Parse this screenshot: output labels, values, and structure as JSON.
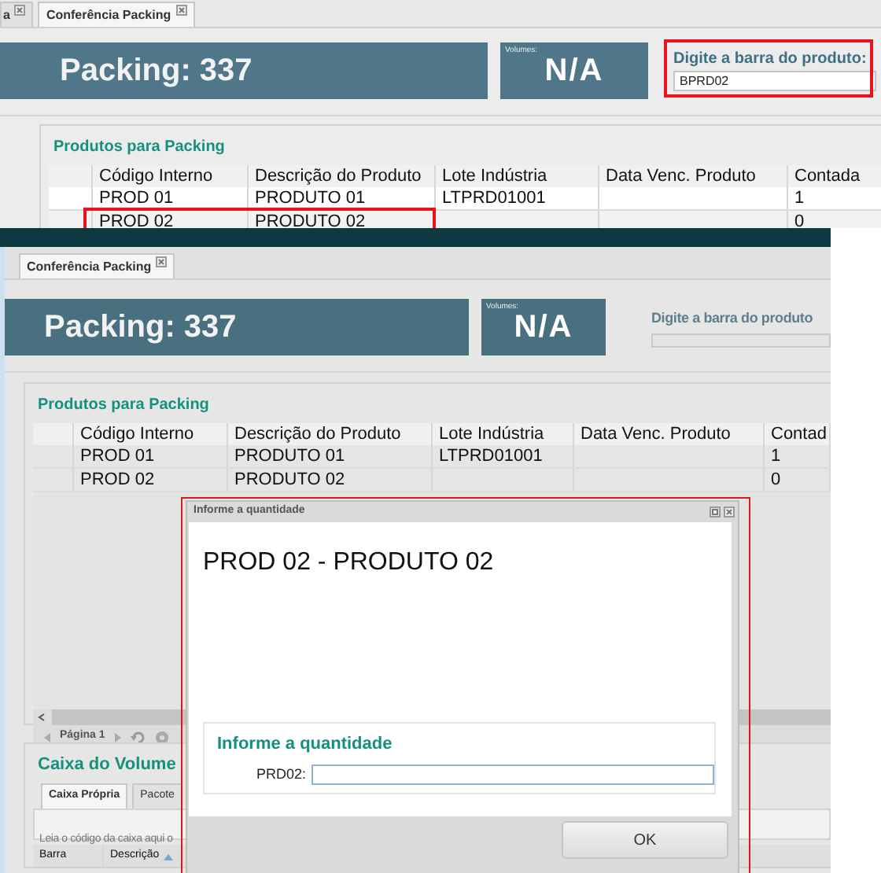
{
  "top_view": {
    "tabs": [
      {
        "label": "a",
        "selected": false
      },
      {
        "label": "Conferência Packing",
        "selected": true
      }
    ],
    "packing_title": "Packing: 337",
    "volumes_label": "Volumes:",
    "volumes_value": "N/A",
    "barcode": {
      "label": "Digite a barra do produto:",
      "value": "BPRD02",
      "highlighted": true
    },
    "products": {
      "legend": "Produtos para Packing",
      "columns": [
        "Código Interno",
        "Descrição do Produto",
        "Lote Indústria",
        "Data Venc. Produto",
        "Contada"
      ],
      "rows": [
        {
          "cells": [
            "PROD 01",
            "PRODUTO 01",
            "LTPRD01001",
            "",
            "1"
          ],
          "highlighted": false
        },
        {
          "cells": [
            "PROD 02",
            "PRODUTO 02",
            "",
            "",
            "0"
          ],
          "highlighted": true
        }
      ]
    }
  },
  "bottom_view": {
    "tabs": [
      {
        "label": "Conferência Packing",
        "selected": true
      }
    ],
    "packing_title": "Packing: 337",
    "volumes_label": "Volumes:",
    "volumes_value": "N/A",
    "barcode": {
      "label": "Digite a barra do produto"
    },
    "products": {
      "legend": "Produtos para Packing",
      "columns": [
        "Código Interno",
        "Descrição do Produto",
        "Lote Indústria",
        "Data Venc. Produto",
        "Contad"
      ],
      "rows": [
        {
          "cells": [
            "PROD 01",
            "PRODUTO 01",
            "LTPRD01001",
            "",
            "1"
          ]
        },
        {
          "cells": [
            "PROD 02",
            "PRODUTO 02",
            "",
            "",
            "0"
          ]
        }
      ]
    },
    "pager": {
      "page_label": "Página 1"
    },
    "volume_box": {
      "legend": "Caixa do Volume",
      "tabs": [
        {
          "label": "Caixa Própria",
          "selected": true
        },
        {
          "label": "Pacote",
          "selected": false
        }
      ],
      "placeholder": "Leia o código da caixa aqui o",
      "columns": [
        "Barra",
        "Descrição"
      ]
    },
    "dialog": {
      "title": "Informe a quantidade",
      "heading": "PROD 02 - PRODUTO 02",
      "legend": "Informe a quantidade",
      "field_label": "PRD02:",
      "button": "OK",
      "highlighted": true
    }
  }
}
